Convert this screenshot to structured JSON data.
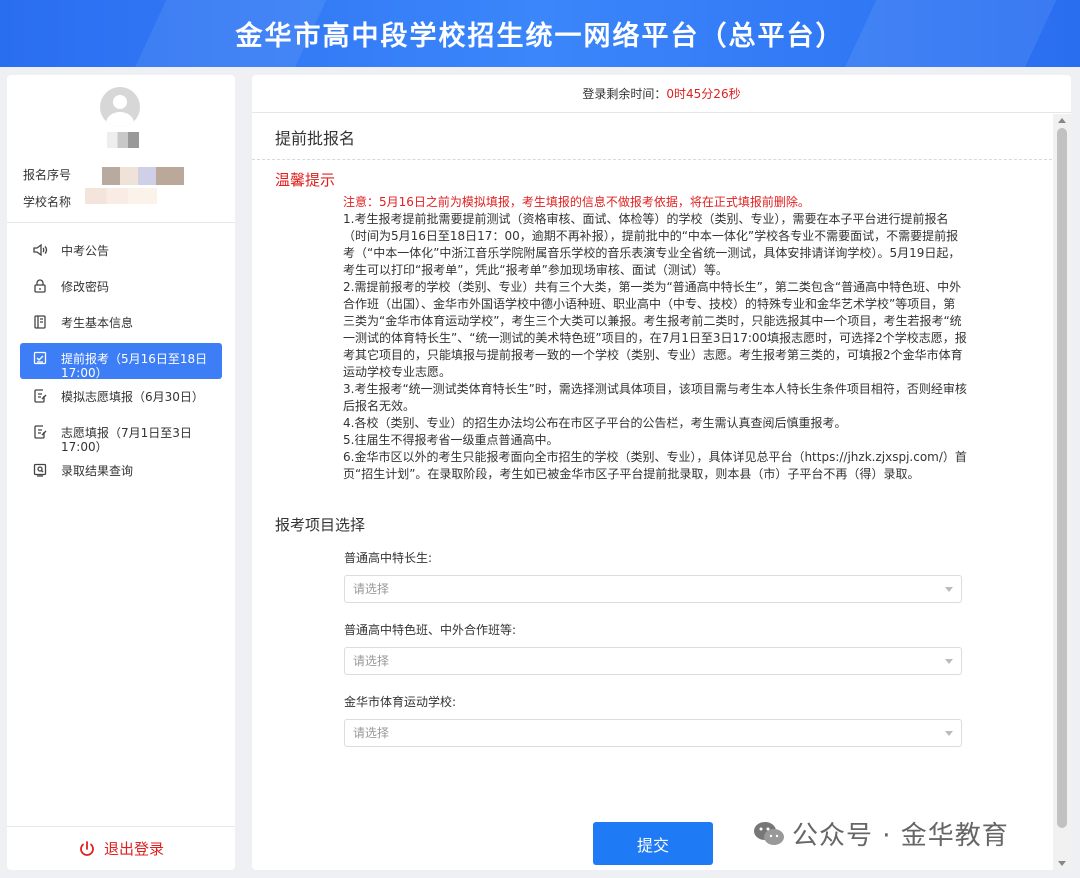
{
  "header": {
    "title": "金华市高中段学校招生统一网络平台（总平台）"
  },
  "profile": {
    "reg_no_label": "报名序号",
    "school_label": "学校名称"
  },
  "menu": [
    {
      "label": "中考公告",
      "icon": "speaker-icon"
    },
    {
      "label": "修改密码",
      "icon": "lock-icon"
    },
    {
      "label": "考生基本信息",
      "icon": "document-icon"
    },
    {
      "label": "提前报考（5月16日至18日17:00）",
      "icon": "checkbox-icon",
      "active": true
    },
    {
      "label": "模拟志愿填报（6月30日）",
      "icon": "edit-icon"
    },
    {
      "label": "志愿填报（7月1日至3日17:00）",
      "icon": "edit-icon"
    },
    {
      "label": "录取结果查询",
      "icon": "search-icon"
    }
  ],
  "logout_label": "退出登录",
  "timer": {
    "label": "登录剩余时间：",
    "value": "0时45分26秒"
  },
  "section_title": "提前批报名",
  "tips_title": "温馨提示",
  "tips": {
    "notice": "注意：5月16日之前为模拟填报，考生填报的信息不做报考依据，将在正式填报前删除。",
    "p1": "1.考生报考提前批需要提前测试（资格审核、面试、体检等）的学校（类别、专业），需要在本子平台进行提前报名（时间为5月16日至18日17：00，逾期不再补报），提前批中的“中本一体化”学校各专业不需要面试，不需要提前报考（“中本一体化”中浙江音乐学院附属音乐学校的音乐表演专业全省统一测试，具体安排请详询学校）。5月19日起，考生可以打印“报考单”，凭此“报考单”参加现场审核、面试（测试）等。",
    "p2": "2.需提前报考的学校（类别、专业）共有三个大类，第一类为“普通高中特长生”，第二类包含“普通高中特色班、中外合作班（出国）、金华市外国语学校中德小语种班、职业高中（中专、技校）的特殊专业和金华艺术学校”等项目，第三类为“金华市体育运动学校”，考生三个大类可以兼报。考生报考前二类时，只能选报其中一个项目，考生若报考“统一测试的体育特长生”、“统一测试的美术特色班”项目的，在7月1日至3日17:00填报志愿时，可选择2个学校志愿，报考其它项目的，只能填报与提前报考一致的一个学校（类别、专业）志愿。考生报考第三类的，可填报2个金华市体育运动学校专业志愿。",
    "p3": "3.考生报考“统一测试类体育特长生”时，需选择测试具体项目，该项目需与考生本人特长生条件项目相符，否则经审核后报名无效。",
    "p4": "4.各校（类别、专业）的招生办法均公布在市区子平台的公告栏，考生需认真查阅后慎重报考。",
    "p5": "5.往届生不得报考省一级重点普通高中。",
    "p6": "6.金华市区以外的考生只能报考面向全市招生的学校（类别、专业），具体详见总平台（https://jhzk.zjxspj.com/）首页“招生计划”。在录取阶段，考生如已被金华市区子平台提前批录取，则本县（市）子平台不再（得）录取。"
  },
  "select_section": "报考项目选择",
  "fields": [
    {
      "label": "普通高中特长生:",
      "placeholder": "请选择"
    },
    {
      "label": "普通高中特色班、中外合作班等:",
      "placeholder": "请选择"
    },
    {
      "label": "金华市体育运动学校:",
      "placeholder": "请选择"
    }
  ],
  "submit_label": "提交",
  "watermark": "公众号 · 金华教育",
  "colors": {
    "primary": "#1e7af5",
    "header": "#2f78f4",
    "alert": "#e02020"
  }
}
